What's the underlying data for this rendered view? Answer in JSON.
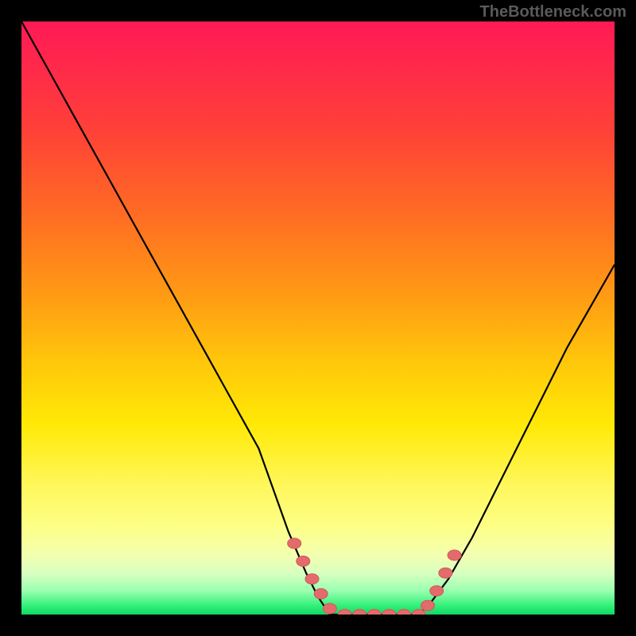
{
  "attribution": "TheBottleneck.com",
  "colors": {
    "frame": "#000000",
    "curve_stroke": "#000000",
    "marker_fill": "#e46b6b",
    "marker_stroke": "#d05858"
  },
  "chart_data": {
    "type": "line",
    "title": "",
    "xlabel": "",
    "ylabel": "",
    "xlim": [
      0,
      100
    ],
    "ylim": [
      0,
      100
    ],
    "note": "Bottleneck-percentage-style curve. Y-axis: bottleneck % (0 at bottom = ideal). Flat zero region roughly x=52–67. Axes and ticks not labeled in image; values are estimated from geometry.",
    "series": [
      {
        "name": "bottleneck-curve",
        "x": [
          0,
          5,
          10,
          15,
          20,
          25,
          30,
          35,
          40,
          45,
          48,
          50,
          52,
          55,
          58,
          61,
          64,
          67,
          69,
          72,
          76,
          80,
          84,
          88,
          92,
          96,
          100
        ],
        "y": [
          100,
          91,
          82,
          73,
          64,
          55,
          46,
          37,
          28,
          14,
          7,
          3,
          0,
          0,
          0,
          0,
          0,
          0,
          2,
          6,
          13,
          21,
          29,
          37,
          45,
          52,
          59
        ]
      }
    ],
    "markers": {
      "name": "highlighted-points",
      "x": [
        46,
        47.5,
        49,
        50.5,
        52,
        54.5,
        57,
        59.5,
        62,
        64.5,
        67,
        68.5,
        70,
        71.5,
        73
      ],
      "y": [
        12,
        9,
        6,
        3.5,
        1,
        0,
        0,
        0,
        0,
        0,
        0,
        1.5,
        4,
        7,
        10
      ]
    }
  }
}
